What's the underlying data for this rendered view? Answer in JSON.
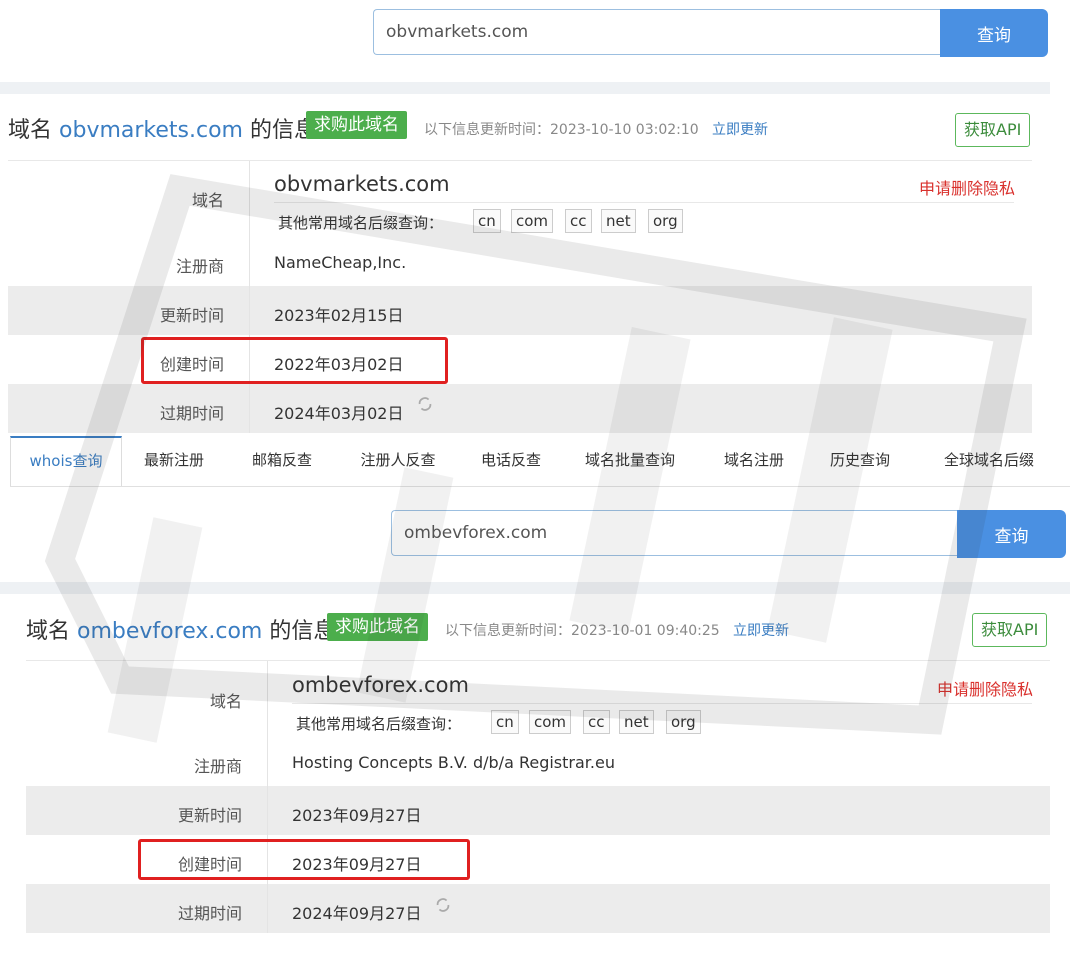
{
  "top": {
    "search_value": "obvmarkets.com",
    "search_button": "查询",
    "title_prefix": "域名",
    "title_domain": "obvmarkets.com",
    "title_suffix": "的信息",
    "buy_badge": "求购此域名",
    "updated_text": "以下信息更新时间：2023-10-10 03:02:10",
    "update_link": "立即更新",
    "api_button": "获取API",
    "fields": {
      "domain_label": "域名",
      "domain_value": "obvmarkets.com",
      "privacy_link": "申请删除隐私",
      "suffix_label": "其他常用域名后缀查询：",
      "suffixes": [
        "cn",
        "com",
        "cc",
        "net",
        "org"
      ],
      "registrar_label": "注册商",
      "registrar_value": "NameCheap,Inc.",
      "updated_label": "更新时间",
      "updated_value": "2023年02月15日",
      "created_label": "创建时间",
      "created_value": "2022年03月02日",
      "expires_label": "过期时间",
      "expires_value": "2024年03月02日"
    }
  },
  "tabs": [
    "whois查询",
    "最新注册",
    "邮箱反查",
    "注册人反查",
    "电话反查",
    "域名批量查询",
    "域名注册",
    "历史查询",
    "全球域名后缀"
  ],
  "bottom": {
    "search_value": "ombevforex.com",
    "search_button": "查询",
    "title_prefix": "域名",
    "title_domain": "ombevforex.com",
    "title_suffix": "的信息",
    "buy_badge": "求购此域名",
    "updated_text": "以下信息更新时间：2023-10-01 09:40:25",
    "update_link": "立即更新",
    "api_button": "获取API",
    "fields": {
      "domain_label": "域名",
      "domain_value": "ombevforex.com",
      "privacy_link": "申请删除隐私",
      "suffix_label": "其他常用域名后缀查询：",
      "suffixes": [
        "cn",
        "com",
        "cc",
        "net",
        "org"
      ],
      "registrar_label": "注册商",
      "registrar_value": "Hosting Concepts B.V. d/b/a Registrar.eu",
      "updated_label": "更新时间",
      "updated_value": "2023年09月27日",
      "created_label": "创建时间",
      "created_value": "2023年09月27日",
      "expires_label": "过期时间",
      "expires_value": "2024年09月27日"
    }
  },
  "colors": {
    "accent": "#4a90e2",
    "link": "#3a7dc2",
    "green": "#4cae4c",
    "highlight": "#e02020",
    "privacy": "#d9302c"
  }
}
